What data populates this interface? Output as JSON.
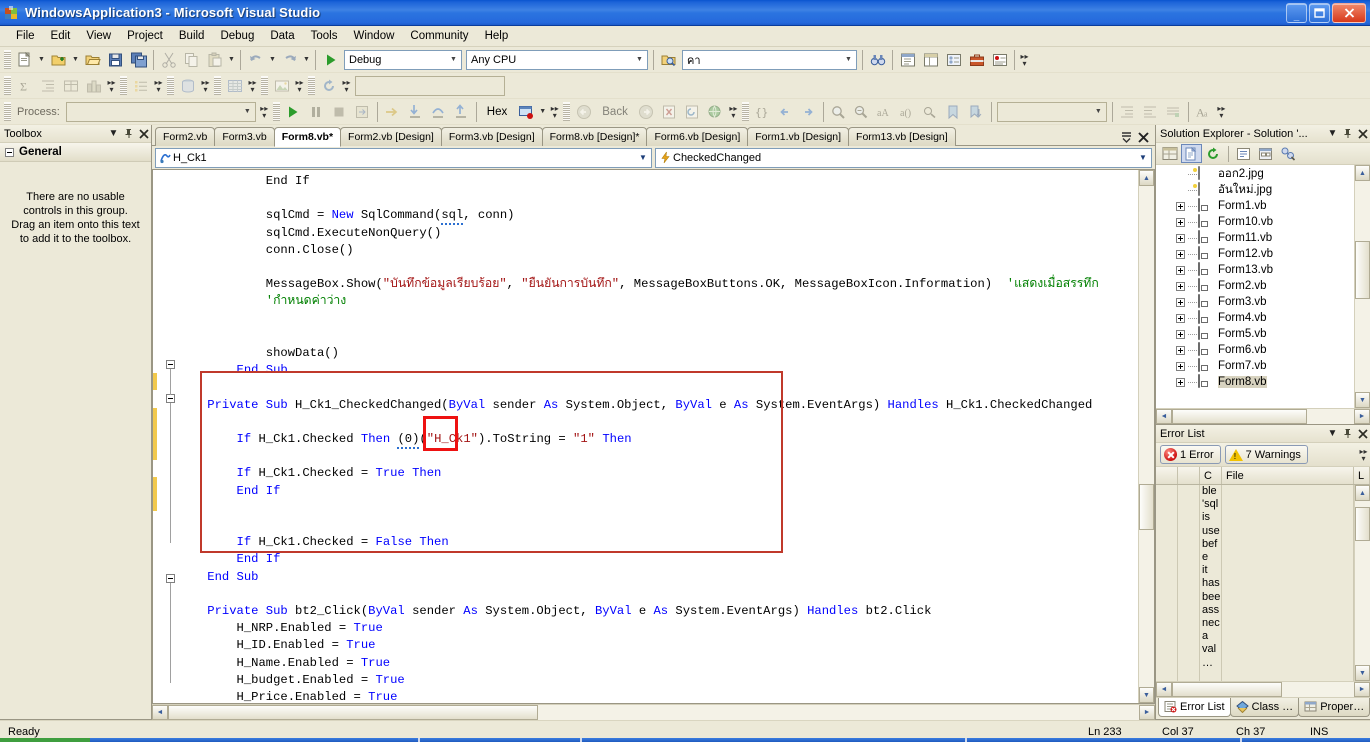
{
  "window": {
    "title": "WindowsApplication3 - Microsoft Visual Studio",
    "minimize_label": "_",
    "maximize_label": "❐",
    "close_label": "✕",
    "app_icon": "visual-studio-icon"
  },
  "menubar": {
    "items": [
      {
        "label": "File"
      },
      {
        "label": "Edit"
      },
      {
        "label": "View"
      },
      {
        "label": "Project"
      },
      {
        "label": "Build"
      },
      {
        "label": "Debug"
      },
      {
        "label": "Data"
      },
      {
        "label": "Tools"
      },
      {
        "label": "Window"
      },
      {
        "label": "Community"
      },
      {
        "label": "Help"
      }
    ]
  },
  "toolbar": {
    "start_label": "Start",
    "config_value": "Debug",
    "platform_value": "Any CPU",
    "find_value": "คา",
    "hex_label": "Hex",
    "process_label": "Process:",
    "process_value": "",
    "back_label": "Back"
  },
  "toolbox": {
    "title": "Toolbox",
    "group_label": "General",
    "empty_text": "There are no usable controls in this group. Drag an item onto this text to add it to the toolbox.",
    "dropdown_icon": "chevron-down-icon",
    "pin_icon": "pin-icon",
    "close_icon": "close-icon"
  },
  "tabs": {
    "items": [
      {
        "label": "Form2.vb",
        "active": false
      },
      {
        "label": "Form3.vb",
        "active": false
      },
      {
        "label": "Form8.vb*",
        "active": true
      },
      {
        "label": "Form2.vb [Design]",
        "active": false
      },
      {
        "label": "Form3.vb [Design]",
        "active": false
      },
      {
        "label": "Form8.vb [Design]*",
        "active": false
      },
      {
        "label": "Form6.vb [Design]",
        "active": false
      },
      {
        "label": "Form1.vb [Design]",
        "active": false
      },
      {
        "label": "Form13.vb [Design]",
        "active": false
      }
    ],
    "list_icon": "tab-list-icon",
    "close_icon": "close-icon"
  },
  "editor": {
    "class_combo": "H_Ck1",
    "class_icon": "control-icon",
    "member_combo": "CheckedChanged",
    "member_icon": "event-lightning-icon",
    "code_lines": [
      "            End If",
      "",
      "            sqlCmd = New SqlCommand(sql, conn)",
      "            sqlCmd.ExecuteNonQuery()",
      "            conn.Close()",
      "",
      "            MessageBox.Show(\"บันทึกข้อมูลเรียบร้อย\", \"ยืนยันการบันทึก\", MessageBoxButtons.OK, MessageBoxIcon.Information)  'แสดงเมื่อสรรทก",
      "            'กำหนดค่าว่าง",
      "",
      "",
      "            showData()",
      "        End Sub",
      "",
      "    Private Sub H_Ck1_CheckedChanged(ByVal sender As System.Object, ByVal e As System.EventArgs) Handles H_Ck1.CheckedChanged",
      "",
      "        If H_Ck1.Checked Then (0)(\"H_Ck1\").ToString = \"1\" Then",
      "",
      "        If H_Ck1.Checked = True Then",
      "        End If",
      "",
      "",
      "        If H_Ck1.Checked = False Then",
      "        End If",
      "    End Sub",
      "",
      "    Private Sub bt2_Click(ByVal sender As System.Object, ByVal e As System.EventArgs) Handles bt2.Click",
      "        H_NRP.Enabled = True",
      "        H_ID.Enabled = True",
      "        H_Name.Enabled = True",
      "        H_budget.Enabled = True",
      "        H_Price.Enabled = True",
      "        H_Ck1.Enabled = True"
    ],
    "annotation_highlight": "(0)"
  },
  "solution_explorer": {
    "title": "Solution Explorer - Solution '...",
    "toolbar_icons": [
      "properties-icon",
      "show-all-files-icon",
      "refresh-icon",
      "view-code-icon",
      "view-designer-icon",
      "class-diagram-icon"
    ],
    "tree": [
      {
        "label": "ออก2.jpg",
        "icon": "image-file-icon",
        "expandable": false,
        "selected": false
      },
      {
        "label": "อันใหม่.jpg",
        "icon": "image-file-icon",
        "expandable": false,
        "selected": false
      },
      {
        "label": "Form1.vb",
        "icon": "form-file-icon",
        "expandable": true,
        "selected": false
      },
      {
        "label": "Form10.vb",
        "icon": "form-file-icon",
        "expandable": true,
        "selected": false
      },
      {
        "label": "Form11.vb",
        "icon": "form-file-icon",
        "expandable": true,
        "selected": false
      },
      {
        "label": "Form12.vb",
        "icon": "form-file-icon",
        "expandable": true,
        "selected": false
      },
      {
        "label": "Form13.vb",
        "icon": "form-file-icon",
        "expandable": true,
        "selected": false
      },
      {
        "label": "Form2.vb",
        "icon": "form-file-icon",
        "expandable": true,
        "selected": false
      },
      {
        "label": "Form3.vb",
        "icon": "form-file-icon",
        "expandable": true,
        "selected": false
      },
      {
        "label": "Form4.vb",
        "icon": "form-file-icon",
        "expandable": true,
        "selected": false
      },
      {
        "label": "Form5.vb",
        "icon": "form-file-icon",
        "expandable": true,
        "selected": false
      },
      {
        "label": "Form6.vb",
        "icon": "form-file-icon",
        "expandable": true,
        "selected": false
      },
      {
        "label": "Form7.vb",
        "icon": "form-file-icon",
        "expandable": true,
        "selected": false
      },
      {
        "label": "Form8.vb",
        "icon": "form-file-icon",
        "expandable": true,
        "selected": true
      }
    ]
  },
  "error_list": {
    "title": "Error List",
    "error_button": "1 Error",
    "warning_button": "7 Warnings",
    "columns": [
      "",
      "",
      "C",
      "File",
      "L"
    ],
    "description_lines": [
      "ble",
      "'sql",
      "is",
      "use",
      "bef",
      "e",
      "it",
      "has",
      "bee",
      "ass",
      "nec",
      "a",
      "val",
      "…"
    ],
    "tabs": [
      {
        "label": "Error List",
        "icon": "error-list-icon",
        "active": true
      },
      {
        "label": "Class …",
        "icon": "class-view-icon",
        "active": false
      },
      {
        "label": "Proper…",
        "icon": "properties-icon",
        "active": false
      }
    ]
  },
  "statusbar": {
    "status": "Ready",
    "line": "Ln 233",
    "column": "Col 37",
    "character": "Ch 37",
    "insert_mode": "INS"
  },
  "colors": {
    "title_blue": "#1B63D8",
    "chrome": "#ece9d8",
    "keyword": "#0000ff",
    "string": "#a31515",
    "comment": "#008000",
    "annotation_red": "#ee1111",
    "selection_highlight": "#d8d3c0"
  }
}
